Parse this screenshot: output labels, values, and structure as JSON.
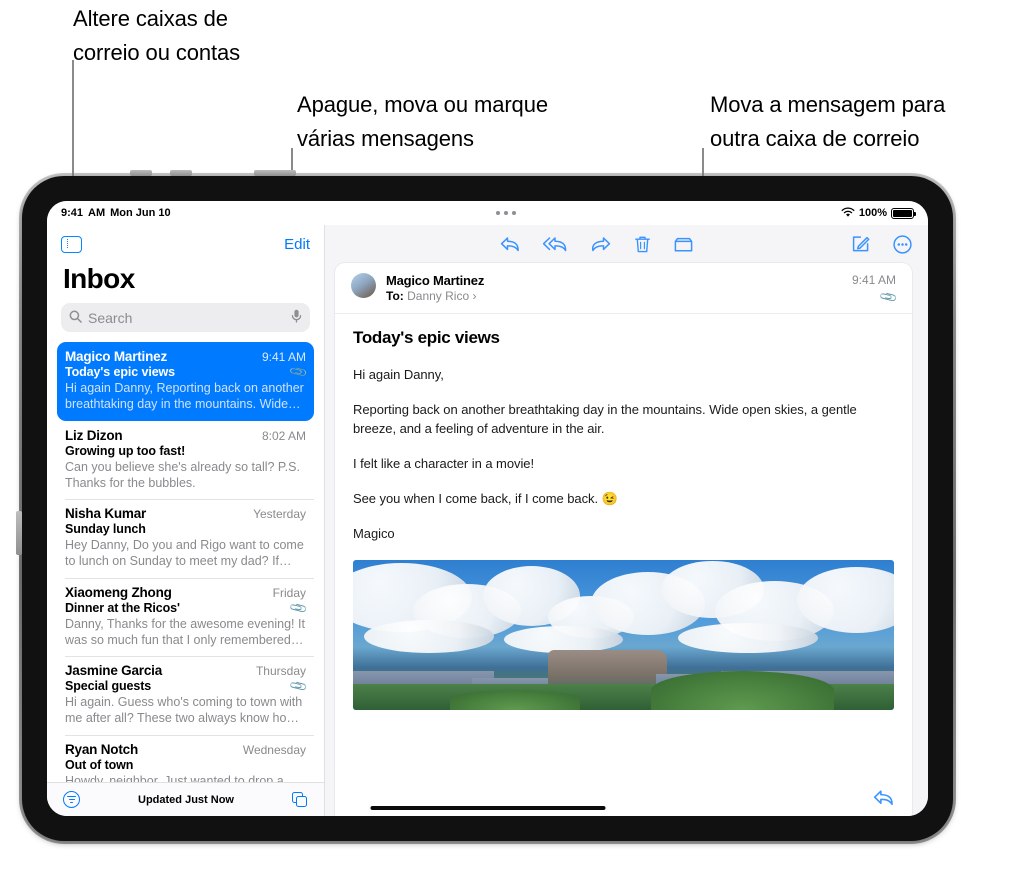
{
  "callouts": [
    {
      "id": "callout-1",
      "text": "Altere caixas de\ncorreio ou contas"
    },
    {
      "id": "callout-2",
      "text": "Apague, mova ou marque\nvárias mensagens"
    },
    {
      "id": "callout-3",
      "text": "Mova a mensagem para\noutra caixa de correio"
    }
  ],
  "status_bar": {
    "time": "9:41",
    "am_pm": "AM",
    "date": "Mon Jun 10",
    "battery_percent": "100%",
    "wifi_icon": "wifi-icon",
    "battery_icon": "battery-icon",
    "recording_dots_icon": "three-dots-icon"
  },
  "list_toolbar": {
    "sidebar_toggle_icon": "sidebar-toggle-icon",
    "edit_label": "Edit"
  },
  "mailbox": {
    "title": "Inbox",
    "search_placeholder": "Search",
    "search_value": "",
    "search_icon": "magnifying-glass-icon",
    "mic_icon": "microphone-icon"
  },
  "messages": [
    {
      "sender": "Magico Martinez",
      "time": "9:41 AM",
      "subject": "Today's epic views",
      "preview": "Hi again Danny, Reporting back on another breathtaking day in the mountains. Wide o...",
      "attachment": true,
      "selected": true
    },
    {
      "sender": "Liz Dizon",
      "time": "8:02 AM",
      "subject": "Growing up too fast!",
      "preview": "Can you believe she's already so tall? P.S. Thanks for the bubbles.",
      "attachment": false,
      "selected": false
    },
    {
      "sender": "Nisha Kumar",
      "time": "Yesterday",
      "subject": "Sunday lunch",
      "preview": "Hey Danny, Do you and Rigo want to come to lunch on Sunday to meet my dad? If you...",
      "attachment": false,
      "selected": false
    },
    {
      "sender": "Xiaomeng Zhong",
      "time": "Friday",
      "subject": "Dinner at the Ricos'",
      "preview": "Danny, Thanks for the awesome evening! It was so much fun that I only remembered t...",
      "attachment": true,
      "selected": false
    },
    {
      "sender": "Jasmine Garcia",
      "time": "Thursday",
      "subject": "Special guests",
      "preview": "Hi again. Guess who's coming to town with me after all? These two always know how t...",
      "attachment": true,
      "selected": false
    },
    {
      "sender": "Ryan Notch",
      "time": "Wednesday",
      "subject": "Out of town",
      "preview": "Howdy, neighbor, Just wanted to drop a quick note to let you know we're leaving T...",
      "attachment": false,
      "selected": false
    }
  ],
  "list_bottom_bar": {
    "filter_icon": "filter-icon",
    "status_text": "Updated Just Now",
    "copy_icon": "copy-icon"
  },
  "message_toolbar": {
    "reply_icon": "reply-arrow-icon",
    "reply_all_icon": "reply-all-arrow-icon",
    "forward_icon": "forward-arrow-icon",
    "trash_icon": "trash-can-icon",
    "move_to_folder_icon": "folder-icon",
    "compose_icon": "compose-pencil-icon",
    "more_icon": "more-ellipsis-circle-icon"
  },
  "message": {
    "avatar_icon": "avatar",
    "sender": "Magico Martinez",
    "to_label": "To:",
    "to_recipient": "Danny Rico",
    "to_chevron": "›",
    "time": "9:41 AM",
    "attachment_icon": "paperclip-icon",
    "subject": "Today's epic views",
    "paragraphs": [
      "Hi again Danny,",
      "Reporting back on another breathtaking day in the mountains. Wide open skies, a gentle breeze, and a feeling of adventure in the air.",
      "I felt like a character in a movie!",
      "See you when I come back, if I come back. 😉",
      "Magico"
    ],
    "photo_alt": "mountain-landscape-photo",
    "footer_reply_icon": "reply-arrow-icon"
  },
  "colors": {
    "accent_blue": "#007aff",
    "toolbar_blue": "#3b93ff",
    "selected_row": "#007aff",
    "secondary_text": "#8a8a8e",
    "pane_background": "#f5f5f7"
  }
}
